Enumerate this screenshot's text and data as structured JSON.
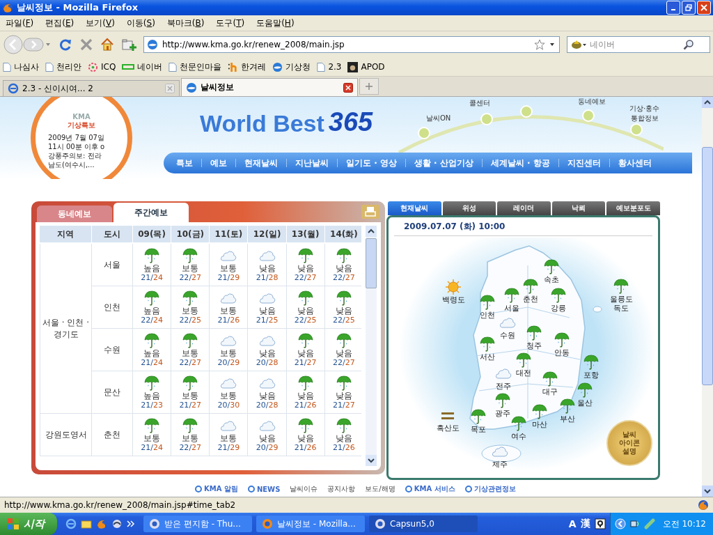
{
  "window": {
    "title": "날씨정보 - Mozilla Firefox"
  },
  "menu": [
    "파일(F)",
    "편집(E)",
    "보기(V)",
    "이동(S)",
    "북마크(B)",
    "도구(T)",
    "도움말(H)"
  ],
  "address": {
    "value": "http://www.kma.go.kr/renew_2008/main.jsp"
  },
  "search": {
    "placeholder": "네이버"
  },
  "bookmarks": [
    {
      "label": "나심사",
      "kind": "page"
    },
    {
      "label": "천리안",
      "kind": "page"
    },
    {
      "label": "ICQ",
      "kind": "flower"
    },
    {
      "label": "네이버",
      "kind": "bar"
    },
    {
      "label": "천문인마을",
      "kind": "page"
    },
    {
      "label": "한겨레",
      "kind": "h"
    },
    {
      "label": "기상청",
      "kind": "globe"
    },
    {
      "label": "2.3",
      "kind": "page"
    },
    {
      "label": "APOD",
      "kind": "photo"
    }
  ],
  "tabs": [
    {
      "label": "2.3 - 신이시여... 2",
      "selected": false
    },
    {
      "label": "날씨정보",
      "selected": true
    }
  ],
  "header": {
    "logo_small": "KMA",
    "logo_title": "기상특보",
    "alert": "2009년 7월 07일\n11시 00분 이후 o\n강풍주의보: 전라\n남도(여수시,...",
    "brand": "World Best",
    "brand_number": "365",
    "arc_links": [
      "날씨ON",
      "콜센터",
      "동네예보",
      "기상·홍수\n통합정보"
    ],
    "nav": [
      "특보",
      "예보",
      "현재날씨",
      "지난날씨",
      "일기도 · 영상",
      "생활 · 산업기상",
      "세계날씨 · 항공",
      "지진센터",
      "황사센터"
    ]
  },
  "forecast": {
    "tabs": [
      {
        "label": "동네예보",
        "selected": false
      },
      {
        "label": "주간예보",
        "selected": true
      }
    ],
    "columns": [
      "지역",
      "도시",
      "09(목)",
      "10(금)",
      "11(토)",
      "12(일)",
      "13(월)",
      "14(화)"
    ],
    "temp_separator": "/",
    "regions": [
      {
        "name": "서울 · 인천 · 경기도",
        "cities": [
          {
            "name": "서울",
            "days": [
              {
                "kind": "rain",
                "chance": "높음",
                "low": "21",
                "high": "24"
              },
              {
                "kind": "rain",
                "chance": "보통",
                "low": "22",
                "high": "27"
              },
              {
                "kind": "cloud",
                "chance": "보통",
                "low": "21",
                "high": "29"
              },
              {
                "kind": "cloud",
                "chance": "낮음",
                "low": "21",
                "high": "28"
              },
              {
                "kind": "rain",
                "chance": "낮음",
                "low": "22",
                "high": "27"
              },
              {
                "kind": "rain",
                "chance": "낮음",
                "low": "22",
                "high": "27"
              }
            ]
          },
          {
            "name": "인천",
            "days": [
              {
                "kind": "rain",
                "chance": "높음",
                "low": "22",
                "high": "24"
              },
              {
                "kind": "rain",
                "chance": "보통",
                "low": "22",
                "high": "25"
              },
              {
                "kind": "cloud",
                "chance": "보통",
                "low": "21",
                "high": "26"
              },
              {
                "kind": "cloud",
                "chance": "낮음",
                "low": "21",
                "high": "25"
              },
              {
                "kind": "rain",
                "chance": "낮음",
                "low": "22",
                "high": "25"
              },
              {
                "kind": "rain",
                "chance": "낮음",
                "low": "22",
                "high": "25"
              }
            ]
          },
          {
            "name": "수원",
            "days": [
              {
                "kind": "rain",
                "chance": "높음",
                "low": "21",
                "high": "24"
              },
              {
                "kind": "rain",
                "chance": "보통",
                "low": "22",
                "high": "27"
              },
              {
                "kind": "cloud",
                "chance": "보통",
                "low": "20",
                "high": "29"
              },
              {
                "kind": "cloud",
                "chance": "낮음",
                "low": "20",
                "high": "28"
              },
              {
                "kind": "rain",
                "chance": "낮음",
                "low": "21",
                "high": "27"
              },
              {
                "kind": "rain",
                "chance": "낮음",
                "low": "22",
                "high": "27"
              }
            ]
          },
          {
            "name": "문산",
            "days": [
              {
                "kind": "rain",
                "chance": "높음",
                "low": "21",
                "high": "23"
              },
              {
                "kind": "rain",
                "chance": "보통",
                "low": "21",
                "high": "27"
              },
              {
                "kind": "cloud",
                "chance": "보통",
                "low": "20",
                "high": "30"
              },
              {
                "kind": "cloud",
                "chance": "낮음",
                "low": "20",
                "high": "28"
              },
              {
                "kind": "rain",
                "chance": "낮음",
                "low": "21",
                "high": "26"
              },
              {
                "kind": "rain",
                "chance": "낮음",
                "low": "21",
                "high": "27"
              }
            ]
          }
        ]
      },
      {
        "name": "강원도영서",
        "cities": [
          {
            "name": "춘천",
            "days": [
              {
                "kind": "rain",
                "chance": "보통",
                "low": "21",
                "high": "24"
              },
              {
                "kind": "rain",
                "chance": "보통",
                "low": "22",
                "high": "27"
              },
              {
                "kind": "cloud",
                "chance": "보통",
                "low": "21",
                "high": "29"
              },
              {
                "kind": "cloud",
                "chance": "낮음",
                "low": "20",
                "high": "29"
              },
              {
                "kind": "rain",
                "chance": "낮음",
                "low": "21",
                "high": "26"
              },
              {
                "kind": "rain",
                "chance": "낮음",
                "low": "21",
                "high": "26"
              }
            ]
          }
        ]
      }
    ]
  },
  "current": {
    "tabs": [
      {
        "label": "현재날씨",
        "selected": true
      },
      {
        "label": "위성",
        "selected": false
      },
      {
        "label": "레이더",
        "selected": false
      },
      {
        "label": "낙뢰",
        "selected": false
      },
      {
        "label": "예보분포도",
        "selected": false
      }
    ],
    "datetime": "2009.07.07 (화) 10:00",
    "stations": [
      {
        "name": "속초",
        "kind": "rain"
      },
      {
        "name": "백령도",
        "kind": "sun"
      },
      {
        "name": "춘천",
        "kind": "rain"
      },
      {
        "name": "서울",
        "kind": "rain"
      },
      {
        "name": "강릉",
        "kind": "rain"
      },
      {
        "name": "인천",
        "kind": "rain"
      },
      {
        "name": "울릉도 독도",
        "kind": "rain"
      },
      {
        "name": "수원",
        "kind": "cloud"
      },
      {
        "name": "청주",
        "kind": "rain"
      },
      {
        "name": "안동",
        "kind": "rain"
      },
      {
        "name": "서산",
        "kind": "rain"
      },
      {
        "name": "대전",
        "kind": "rain"
      },
      {
        "name": "포항",
        "kind": "rain"
      },
      {
        "name": "전주",
        "kind": "cloud"
      },
      {
        "name": "대구",
        "kind": "rain"
      },
      {
        "name": "울산",
        "kind": "rain"
      },
      {
        "name": "광주",
        "kind": "rain"
      },
      {
        "name": "부산",
        "kind": "rain"
      },
      {
        "name": "마산",
        "kind": "rain"
      },
      {
        "name": "흑산도",
        "kind": "haze"
      },
      {
        "name": "목포",
        "kind": "rain"
      },
      {
        "name": "여수",
        "kind": "rain"
      },
      {
        "name": "제주",
        "kind": "cloud"
      }
    ],
    "legend_button": "날씨\n아이콘\n설명"
  },
  "footer_links": [
    {
      "label": "KMA 알림",
      "kind": "heading"
    },
    {
      "label": "NEWS",
      "kind": "heading"
    },
    {
      "label": "날씨이슈",
      "kind": "link"
    },
    {
      "label": "공지사항",
      "kind": "link"
    },
    {
      "label": "보도/해명",
      "kind": "link"
    },
    {
      "label": "KMA 서비스",
      "kind": "heading"
    },
    {
      "label": "기상관련정보",
      "kind": "heading"
    }
  ],
  "status_bar": "http://www.kma.go.kr/renew_2008/main.jsp#time_tab2",
  "taskbar": {
    "start": "시작",
    "tasks": [
      {
        "label": "받은 편지함 - Thu...",
        "selected": false
      },
      {
        "label": "날씨정보 - Mozilla...",
        "selected": false
      },
      {
        "label": "Capsun5,0",
        "selected": true
      }
    ],
    "tray": [
      "A",
      "漢"
    ],
    "clock": "오전 10:12"
  }
}
